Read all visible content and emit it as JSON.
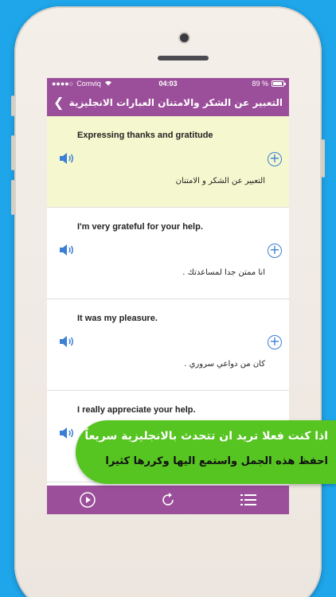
{
  "status_bar": {
    "carrier": "Comviq",
    "time": "04:03",
    "battery": "89 %"
  },
  "navbar": {
    "title": "التعبير عن الشكر والامتنان العبارات الانجليزية",
    "back_icon": "chevron-left-icon"
  },
  "phrases": [
    {
      "english": "Expressing thanks and gratitude",
      "arabic": "التعبير عن الشكر و الامتنان"
    },
    {
      "english": "I'm very grateful for your help.",
      "arabic": "انا ممتن جدا لمساعدتك ."
    },
    {
      "english": "It was my pleasure.",
      "arabic": "كان من دواعي سروري ."
    },
    {
      "english": "I really appreciate your help.",
      "arabic": ""
    }
  ],
  "toolbar": {
    "icons": [
      "play-icon",
      "repeat-icon",
      "list-icon"
    ]
  },
  "banner": {
    "line1": "اذا كنت فعلا تريد ان تتحدث بالانجليزية سريعاً",
    "line2": "احفظ هذه الجمل واستمع اليها وكررها كثيرا"
  },
  "colors": {
    "background": "#1fa6ea",
    "accent_purple": "#9b4f9a",
    "highlight_row": "#f5f8cf",
    "banner_green": "#56c421",
    "icon_blue": "#3b7fd6"
  }
}
